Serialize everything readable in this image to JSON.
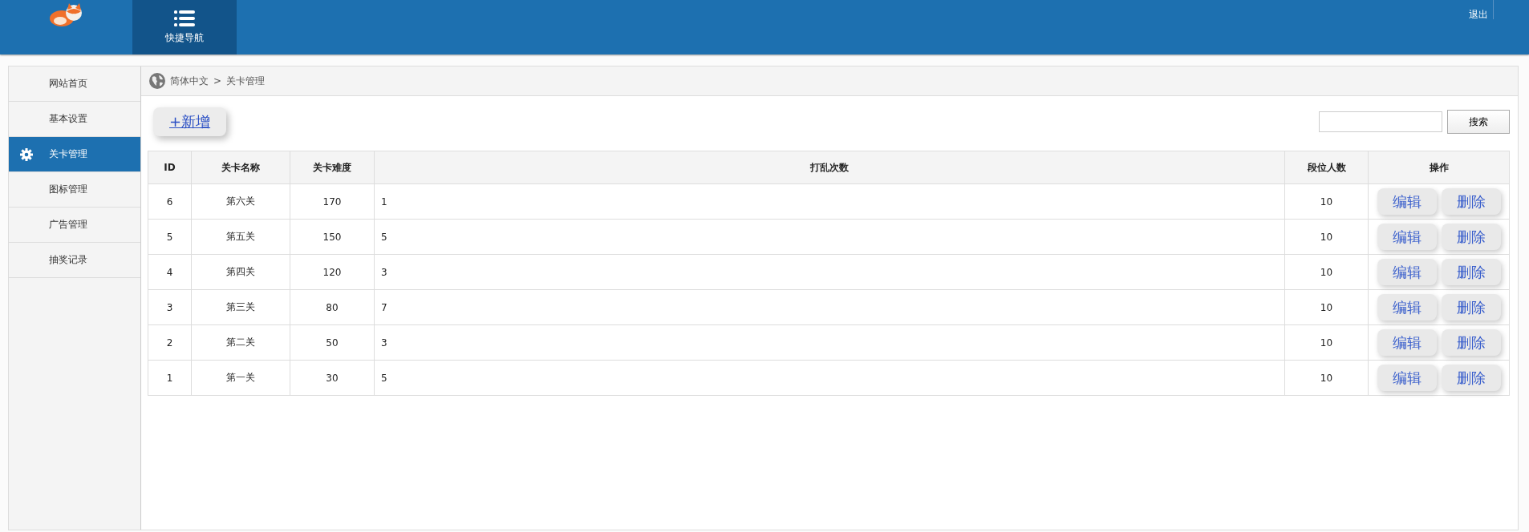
{
  "header": {
    "nav": [
      {
        "label": "快捷导航",
        "selected": true
      }
    ],
    "logout": "退出"
  },
  "sidebar": {
    "items": [
      {
        "label": "网站首页",
        "selected": false
      },
      {
        "label": "基本设置",
        "selected": false
      },
      {
        "label": "关卡管理",
        "selected": true
      },
      {
        "label": "图标管理",
        "selected": false
      },
      {
        "label": "广告管理",
        "selected": false
      },
      {
        "label": "抽奖记录",
        "selected": false
      }
    ]
  },
  "breadcrumb": {
    "items": [
      "简体中文",
      "关卡管理"
    ],
    "separator": ">"
  },
  "toolbar": {
    "add_button": "+新增",
    "search_button": "搜索"
  },
  "table": {
    "columns": [
      "ID",
      "关卡名称",
      "关卡难度",
      "打乱次数",
      "段位人数",
      "操作"
    ],
    "rows": [
      {
        "cells": [
          "6",
          "第六关",
          "170",
          "1",
          "10"
        ],
        "actions": [
          "编辑",
          "删除"
        ]
      },
      {
        "cells": [
          "5",
          "第五关",
          "150",
          "5",
          "10"
        ],
        "actions": [
          "编辑",
          "删除"
        ]
      },
      {
        "cells": [
          "4",
          "第四关",
          "120",
          "3",
          "10"
        ],
        "actions": [
          "编辑",
          "删除"
        ]
      },
      {
        "cells": [
          "3",
          "第三关",
          "80",
          "7",
          "10"
        ],
        "actions": [
          "编辑",
          "删除"
        ]
      },
      {
        "cells": [
          "2",
          "第二关",
          "50",
          "3",
          "10"
        ],
        "actions": [
          "编辑",
          "删除"
        ]
      },
      {
        "cells": [
          "1",
          "第一关",
          "30",
          "5",
          "10"
        ],
        "actions": [
          "编辑",
          "删除"
        ]
      }
    ]
  }
}
